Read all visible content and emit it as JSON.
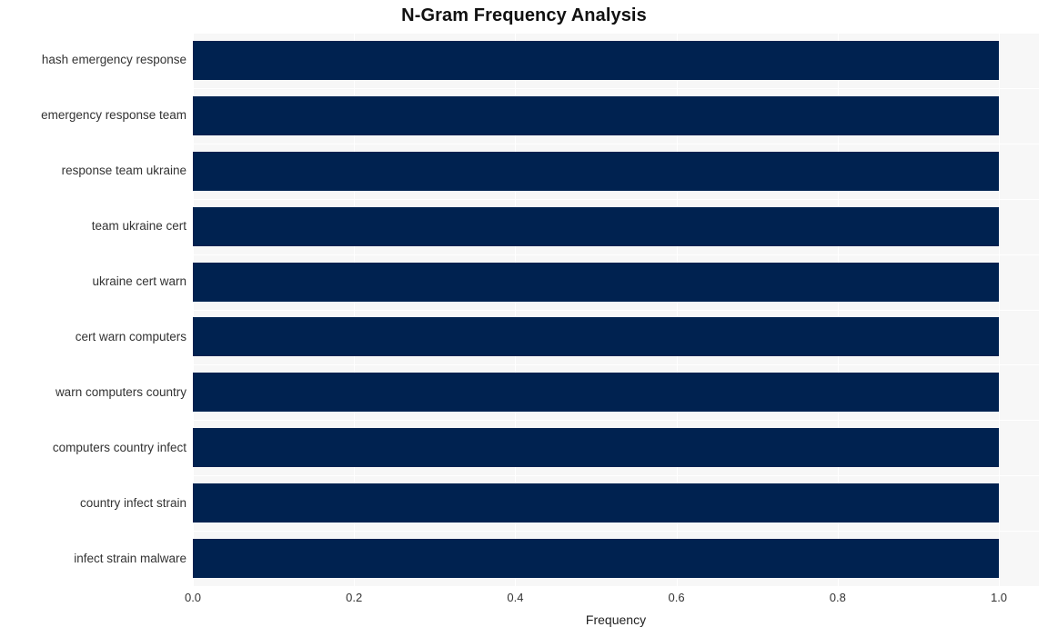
{
  "chart_data": {
    "type": "bar",
    "orientation": "horizontal",
    "title": "N-Gram Frequency Analysis",
    "xlabel": "Frequency",
    "ylabel": "",
    "xlim": [
      0.0,
      1.0
    ],
    "xticks": [
      "0.0",
      "0.2",
      "0.4",
      "0.6",
      "0.8",
      "1.0"
    ],
    "xtick_values": [
      0.0,
      0.2,
      0.4,
      0.6,
      0.8,
      1.0
    ],
    "grid": true,
    "legend": "none",
    "bar_color": "#002250",
    "plot_background": "#f7f7f7",
    "gridline_color": "#ffffff",
    "categories": [
      "hash emergency response",
      "emergency response team",
      "response team ukraine",
      "team ukraine cert",
      "ukraine cert warn",
      "cert warn computers",
      "warn computers country",
      "computers country infect",
      "country infect strain",
      "infect strain malware"
    ],
    "values": [
      1.0,
      1.0,
      1.0,
      1.0,
      1.0,
      1.0,
      1.0,
      1.0,
      1.0,
      1.0
    ]
  }
}
